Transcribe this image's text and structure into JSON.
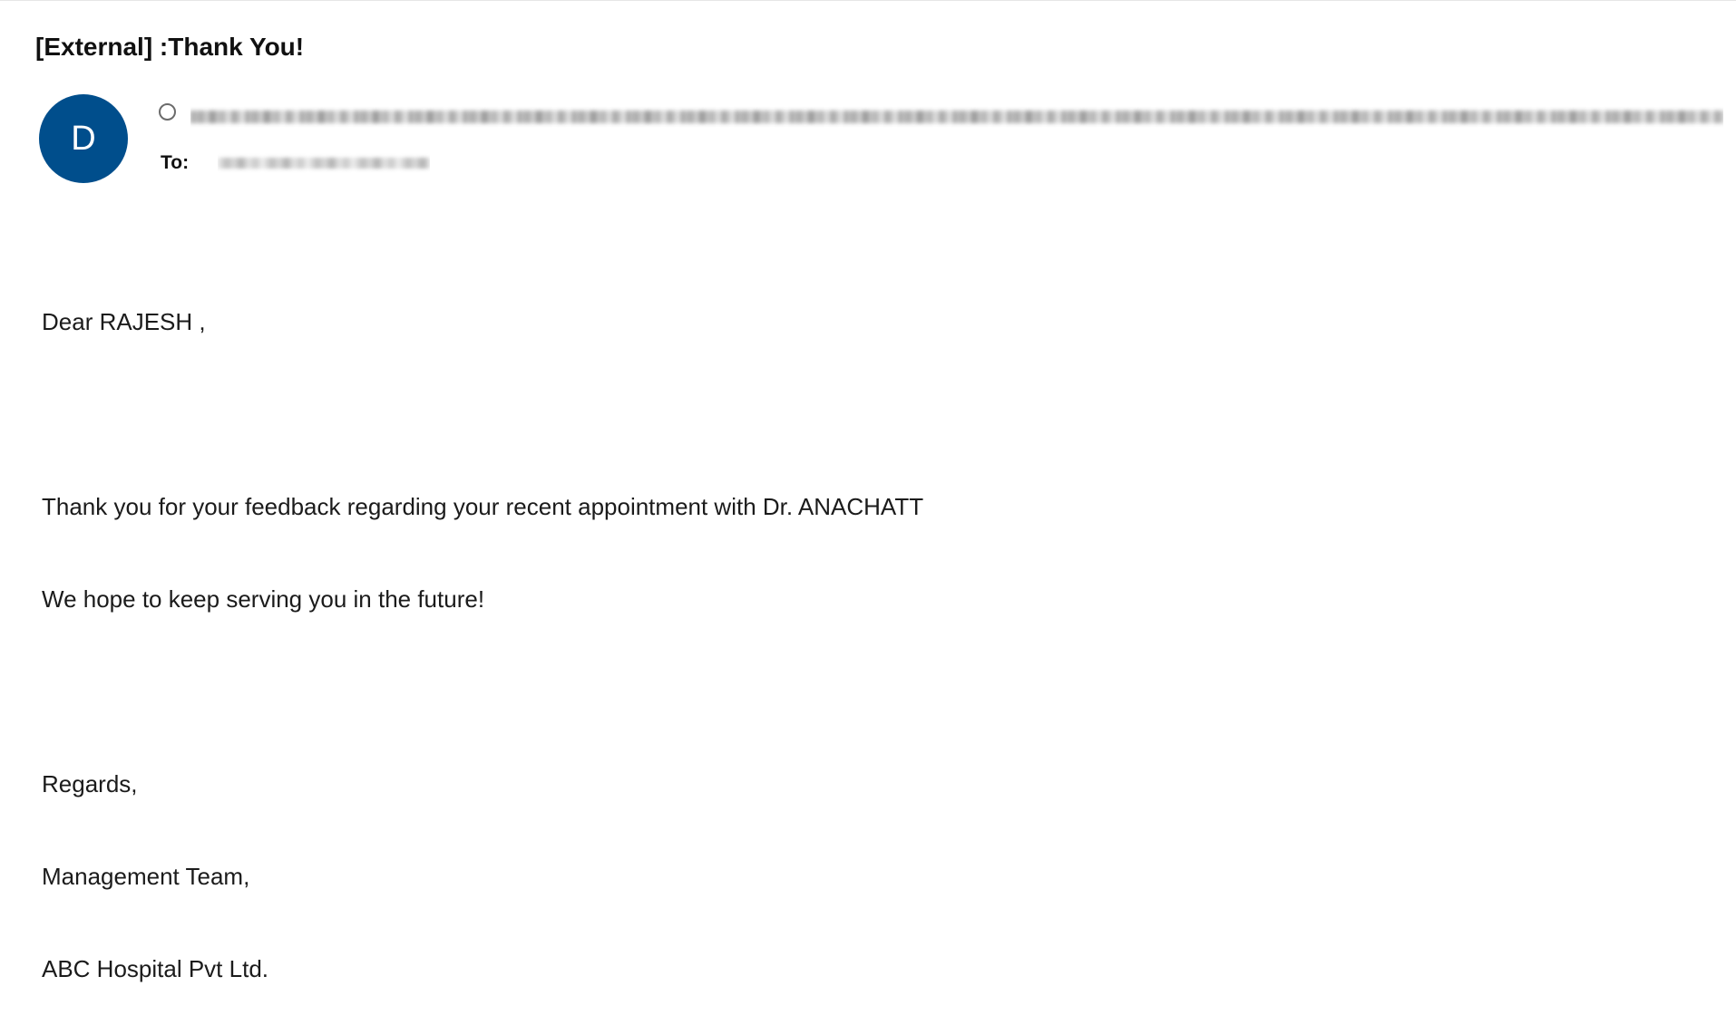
{
  "email": {
    "subject": "[External] :Thank You!",
    "avatar_initial": "D",
    "to_label": "To:",
    "body": {
      "greeting": "Dear RAJESH ,",
      "line1": "Thank you for your feedback regarding your recent appointment with Dr. ANACHATT",
      "line2": "We hope to keep serving you in the future!",
      "sign_off": "Regards,",
      "team": "Management Team,",
      "company": "ABC Hospital Pvt Ltd."
    }
  },
  "icons": {
    "presence": "presence-status-icon"
  },
  "colors": {
    "avatar_bg": "#004e8c",
    "avatar_text": "#ffffff",
    "text": "#1b1b1b"
  }
}
